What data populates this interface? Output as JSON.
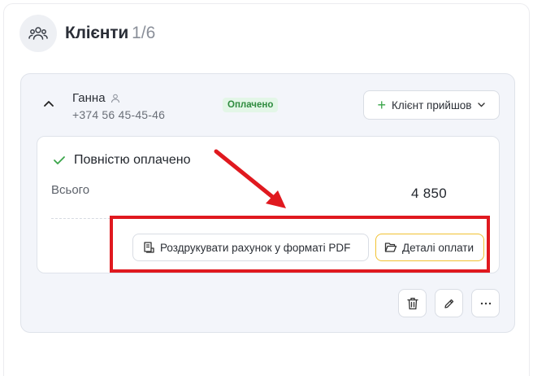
{
  "header": {
    "title": "Клієнти",
    "count": "1/6",
    "icon": "users-icon"
  },
  "client": {
    "name": "Ганна",
    "phone": "+374 56 45-45-46",
    "status": "Оплачено",
    "arrived_button": "Клієнт прийшов"
  },
  "payment": {
    "status": "Повністю оплачено",
    "total_label": "Всього",
    "total_value": "4 850",
    "print_button": "Роздрукувати рахунок у форматі PDF",
    "details_button": "Деталі оплати"
  },
  "actions": [
    "delete-icon",
    "edit-icon",
    "more-icon"
  ],
  "colors": {
    "status_badge_bg": "#e3f6e7",
    "status_badge_text": "#2e8b3e",
    "details_border": "#f1c232",
    "highlight": "#e0191f"
  }
}
